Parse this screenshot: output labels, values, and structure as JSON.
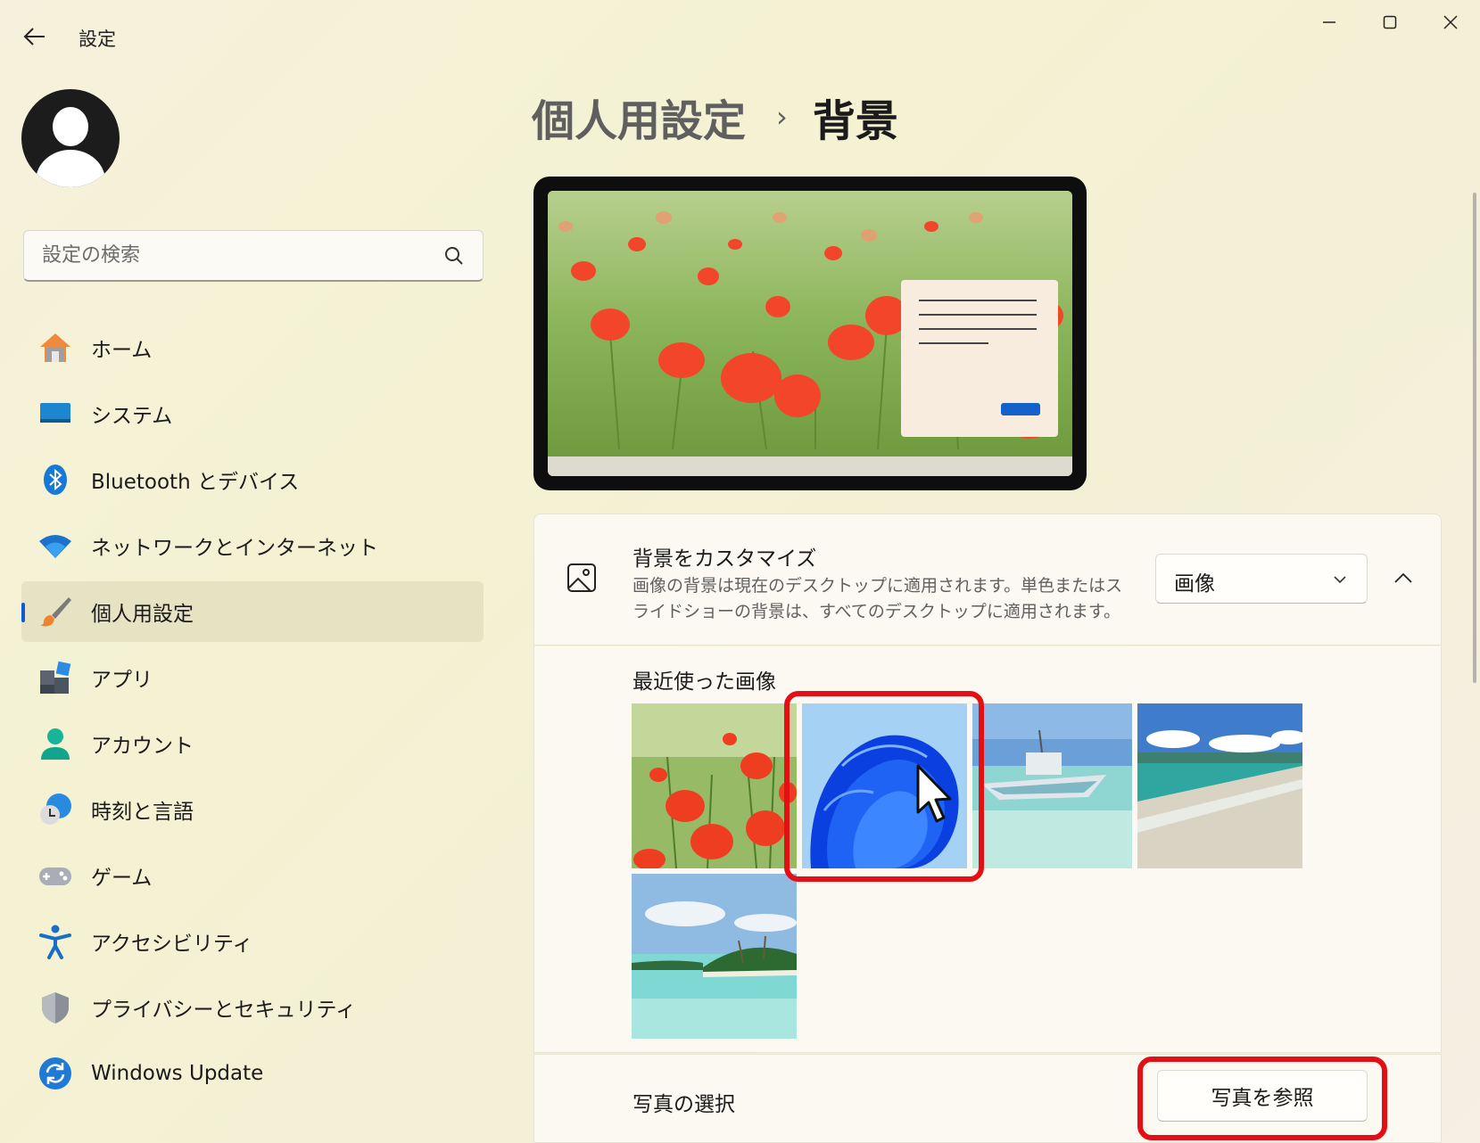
{
  "window": {
    "title": "設定",
    "controls": [
      "minimize-icon",
      "maximize-icon",
      "close-icon"
    ]
  },
  "search": {
    "placeholder": "設定の検索"
  },
  "sidebar": {
    "items": [
      {
        "label": "ホーム",
        "icon": "home-icon"
      },
      {
        "label": "システム",
        "icon": "system-icon"
      },
      {
        "label": "Bluetooth とデバイス",
        "icon": "bluetooth-icon"
      },
      {
        "label": "ネットワークとインターネット",
        "icon": "wifi-icon"
      },
      {
        "label": "個人用設定",
        "icon": "brush-icon",
        "active": true
      },
      {
        "label": "アプリ",
        "icon": "apps-icon"
      },
      {
        "label": "アカウント",
        "icon": "account-icon"
      },
      {
        "label": "時刻と言語",
        "icon": "time-language-icon"
      },
      {
        "label": "ゲーム",
        "icon": "gamepad-icon"
      },
      {
        "label": "アクセシビリティ",
        "icon": "accessibility-icon"
      },
      {
        "label": "プライバシーとセキュリティ",
        "icon": "shield-icon"
      },
      {
        "label": "Windows Update",
        "icon": "update-icon"
      }
    ]
  },
  "breadcrumb": {
    "parent": "個人用設定",
    "separator": "›",
    "current": "背景"
  },
  "customize": {
    "title": "背景をカスタマイズ",
    "description": "画像の背景は現在のデスクトップに適用されます。単色またはスライドショーの背景は、すべてのデスクトップに適用されます。",
    "dropdown_value": "画像"
  },
  "recent": {
    "label": "最近使った画像",
    "images": [
      "poppies-image",
      "windows-bloom-image",
      "boat-image",
      "beach-image",
      "island-image"
    ],
    "selected_index": 1
  },
  "choose_photo": {
    "label": "写真の選択",
    "button": "写真を参照"
  },
  "colors": {
    "accent": "#0b5cd5",
    "highlight": "#e30f14"
  }
}
